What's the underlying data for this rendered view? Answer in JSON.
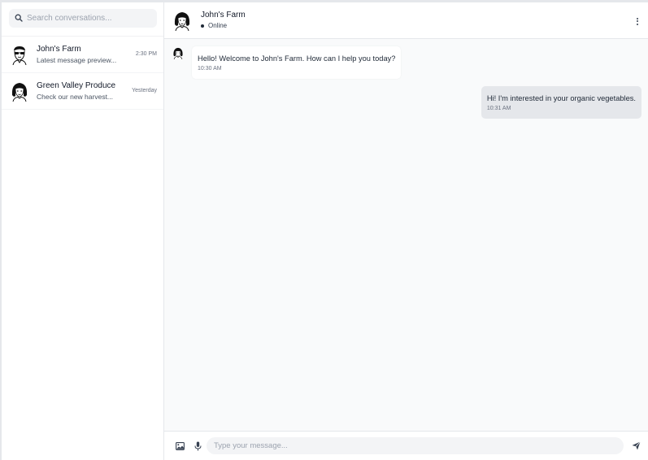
{
  "search": {
    "placeholder": "Search conversations..."
  },
  "conversations": [
    {
      "name": "John's Farm",
      "preview": "Latest message preview...",
      "time": "2:30 PM",
      "avatar_icon": "man-sunglasses-avatar-icon"
    },
    {
      "name": "Green Valley Produce",
      "preview": "Check our new harvest...",
      "time": "Yesterday",
      "avatar_icon": "woman-avatar-icon"
    }
  ],
  "chat_header": {
    "name": "John's Farm",
    "status": "Online"
  },
  "messages": [
    {
      "direction": "incoming",
      "text": "Hello! Welcome to John's Farm. How can I help you today?",
      "time": "10:30 AM"
    },
    {
      "direction": "outgoing",
      "text": "Hi! I'm interested in your organic vegetables.",
      "time": "10:31 AM"
    }
  ],
  "composer": {
    "placeholder": "Type your message..."
  },
  "colors": {
    "status_dot": "#1f2937",
    "outgoing_bubble": "#e5e7eb",
    "chat_background": "#f9fafb"
  }
}
